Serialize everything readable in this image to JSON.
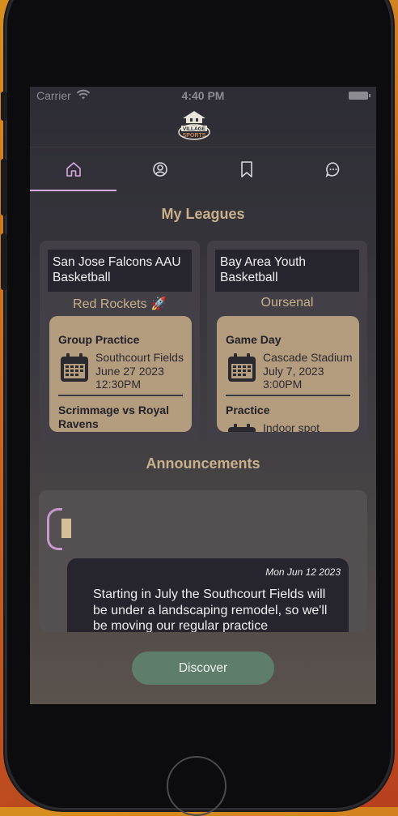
{
  "status_bar": {
    "carrier": "Carrier",
    "time": "4:40 PM"
  },
  "tabs": [
    {
      "icon": "home-icon",
      "active": true
    },
    {
      "icon": "profile-icon",
      "active": false
    },
    {
      "icon": "bookmark-icon",
      "active": false
    },
    {
      "icon": "chat-icon",
      "active": false
    }
  ],
  "colors": {
    "accent": "#d8a8e0",
    "gold": "#c9b08b",
    "card": "#b49c7e",
    "discover": "#5f7d6b"
  },
  "leagues_title": "My Leagues",
  "leagues": [
    {
      "name": "San Jose Falcons AAU Basketball",
      "team": "Red Rockets 🚀",
      "events": [
        {
          "title": "Group Practice",
          "location": "Southcourt Fields",
          "date": "June 27 2023",
          "time": "12:30PM"
        },
        {
          "title": "Scrimmage vs Royal Ravens"
        }
      ]
    },
    {
      "name": "Bay Area Youth Basketball",
      "team": "Oursenal",
      "events": [
        {
          "title": "Game Day",
          "location": "Cascade Stadium",
          "date": "July 7, 2023",
          "time": "3:00PM"
        },
        {
          "title": "Practice",
          "location": "Indoor spot"
        }
      ]
    }
  ],
  "announcements_title": "Announcements",
  "announcement": {
    "date": "Mon Jun 12 2023",
    "text": "Starting in July the Southcourt Fields will be under a landscaping remodel, so we'll be moving our regular practice"
  },
  "discover_label": "Discover"
}
